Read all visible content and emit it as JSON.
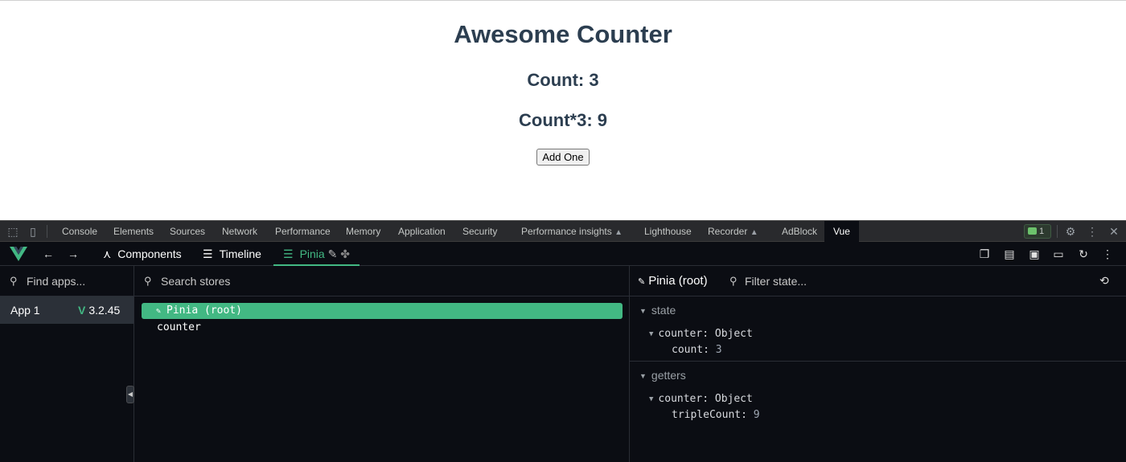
{
  "app": {
    "title": "Awesome Counter",
    "count_text": "Count: 3",
    "triple_text": "Count*3: 9",
    "add_button": "Add One"
  },
  "devtools": {
    "tabs": [
      "Console",
      "Elements",
      "Sources",
      "Network",
      "Performance",
      "Memory",
      "Application",
      "Security",
      "Performance insights",
      "Lighthouse",
      "Recorder",
      "AdBlock",
      "Vue"
    ],
    "active_tab": "Vue",
    "messages_count": "1",
    "icons": {
      "inspect": "inspect-element-icon",
      "device": "device-toggle-icon",
      "settings": "gear-icon",
      "more": "more-vert-icon",
      "close": "close-icon"
    }
  },
  "vue": {
    "nav": {
      "components": "Components",
      "timeline": "Timeline",
      "pinia": "Pinia"
    },
    "apps": {
      "search_placeholder": "Find apps...",
      "items": [
        {
          "name": "App 1",
          "version": "3.2.45"
        }
      ]
    },
    "stores": {
      "search_placeholder": "Search stores",
      "root": "Pinia (root)",
      "items": [
        "counter"
      ]
    },
    "inspector": {
      "title": "Pinia (root)",
      "filter_placeholder": "Filter state...",
      "state_label": "state",
      "state_obj_key": "counter:",
      "state_obj_type": "Object",
      "state_field_key": "count:",
      "state_field_value": "3",
      "getters_label": "getters",
      "getters_obj_key": "counter:",
      "getters_obj_type": "Object",
      "getters_field_key": "tripleCount:",
      "getters_field_value": "9"
    }
  },
  "colors": {
    "accent": "#42b883",
    "devtools_bg": "#0b0d13",
    "tabbar_bg": "#292a2d",
    "text_dark": "#2c3e50"
  }
}
